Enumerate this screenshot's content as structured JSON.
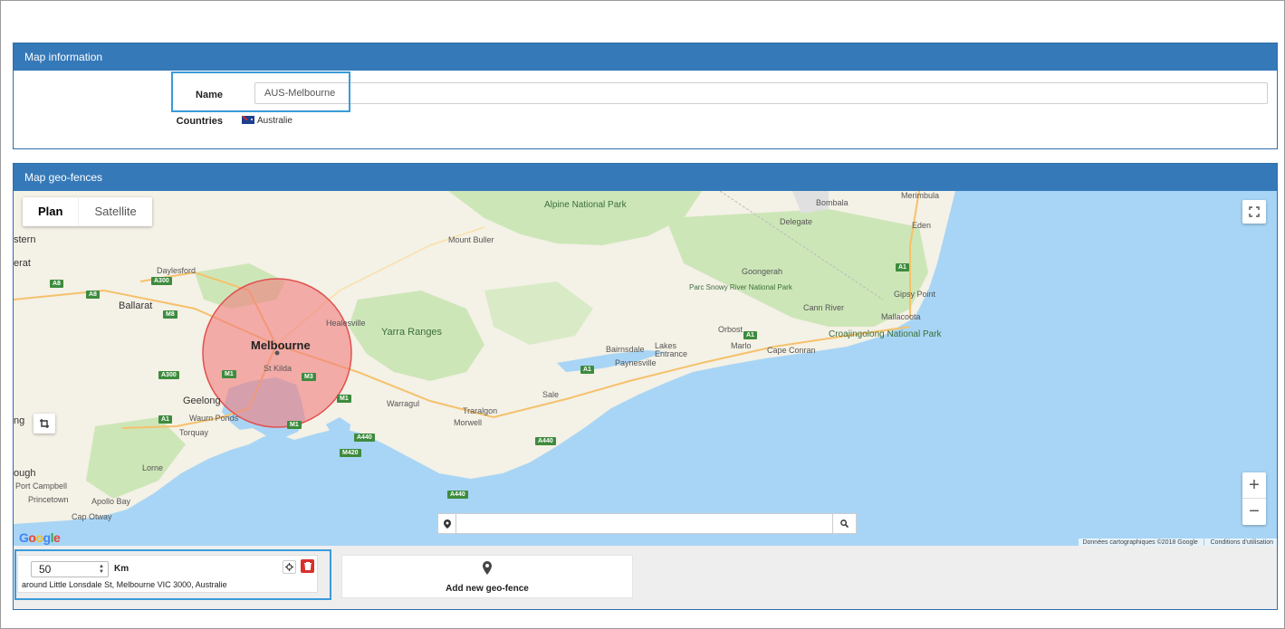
{
  "info_panel": {
    "title": "Map information",
    "name_label": "Name",
    "name_value": "AUS-Melbourne",
    "countries_label": "Countries",
    "country": "Australie"
  },
  "geo_panel": {
    "title": "Map geo-fences",
    "map_type": {
      "plan": "Plan",
      "satellite": "Satellite",
      "active": "plan"
    },
    "labels": {
      "melbourne": "Melbourne",
      "st_kilda": "St Kilda",
      "ballarat": "Ballarat",
      "daylesford": "Daylesford",
      "healesville": "Healesville",
      "yarra_ranges": "Yarra Ranges",
      "geelong": "Geelong",
      "waurn_ponds": "Waurn Ponds",
      "torquay": "Torquay",
      "warragul": "Warragul",
      "traralgon": "Traralgon",
      "morwell": "Morwell",
      "sale": "Sale",
      "bairnsdale": "Bairnsdale",
      "lakes_entrance": "Lakes Entrance",
      "paynesville": "Paynesville",
      "orbost": "Orbost",
      "marlo": "Marlo",
      "cape_conran": "Cape Conran",
      "croajingolong": "Croajingolong National Park",
      "alpine": "Alpine National Park",
      "mount_buller": "Mount Buller",
      "parc_snowy": "Parc Snowy River National Park",
      "goongerah": "Goongerah",
      "cann_river": "Cann River",
      "gipsy_point": "Gipsy Point",
      "mallacoota": "Mallacoota",
      "bombala": "Bombala",
      "delegate": "Delegate",
      "eden": "Eden",
      "merimbula": "Merimbula",
      "lorne": "Lorne",
      "port_campbell": "Port Campbell",
      "princetown": "Princetown",
      "apollo_bay": "Apollo Bay",
      "cap_otway": "Cap Otway",
      "stern": "stern",
      "erat": "erat",
      "ng": "ng",
      "ough": "ough"
    },
    "road_shields": [
      "A8",
      "A300",
      "A8",
      "M8",
      "A300",
      "M1",
      "M3",
      "M1",
      "A1",
      "A440",
      "M420",
      "A440",
      "A1",
      "A1",
      "A1",
      "M1",
      "A440"
    ],
    "google_logo": "Google",
    "attribution": "Données cartographiques ©2018 Google",
    "terms": "Conditions d'utilisation",
    "zoom_in": "+",
    "zoom_out": "−",
    "search_placeholder": "",
    "fence": {
      "radius": "50",
      "unit": "Km",
      "address": "around Little Lonsdale St, Melbourne VIC 3000, Australie"
    },
    "add_label": "Add new geo-fence",
    "colors": {
      "header": "#3579b8",
      "circle_fill": "#f08080",
      "circle_stroke": "#e05050",
      "water": "#a8d5f5",
      "land": "#f4f1e6",
      "park": "#cde6b8",
      "delete": "#d9302c"
    }
  }
}
